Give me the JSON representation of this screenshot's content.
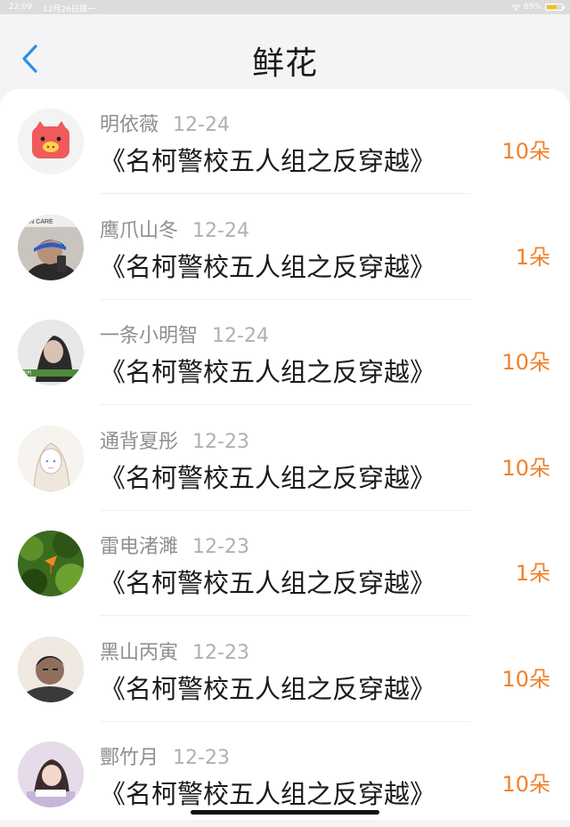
{
  "status_bar": {
    "time": "22:09",
    "date": "12月26日周一",
    "battery": "69%",
    "battery_level": 0.69
  },
  "nav": {
    "title": "鲜花",
    "back_icon": "chevron-left-icon"
  },
  "colors": {
    "accent_blue": "#2f8ee8",
    "amount_orange": "#f0822d",
    "name_gray": "#8e8e93"
  },
  "items": [
    {
      "name": "明依薇",
      "date": "12-24",
      "book": "《名柯警校五人组之反穿越》",
      "amount": "10朵",
      "avatar": "pink-pig-avatar"
    },
    {
      "name": "鹰爪山冬",
      "date": "12-24",
      "book": "《名柯警校五人组之反穿越》",
      "amount": "1朵",
      "avatar": "person-blue-cap-avatar"
    },
    {
      "name": "一条小明智",
      "date": "12-24",
      "book": "《名柯警校五人组之反穿越》",
      "amount": "10朵",
      "avatar": "girl-photo-avatar"
    },
    {
      "name": "通背夏彤",
      "date": "12-23",
      "book": "《名柯警校五人组之反穿越》",
      "amount": "10朵",
      "avatar": "sketch-girl-avatar"
    },
    {
      "name": "雷电渚濉",
      "date": "12-23",
      "book": "《名柯警校五人组之反穿越》",
      "amount": "1朵",
      "avatar": "green-leaves-avatar"
    },
    {
      "name": "黑山丙寅",
      "date": "12-23",
      "book": "《名柯警校五人组之反穿越》",
      "amount": "10朵",
      "avatar": "man-portrait-avatar"
    },
    {
      "name": "酆竹月",
      "date": "12-23",
      "book": "《名柯警校五人组之反穿越》",
      "amount": "10朵",
      "avatar": "girl-reading-avatar"
    }
  ]
}
